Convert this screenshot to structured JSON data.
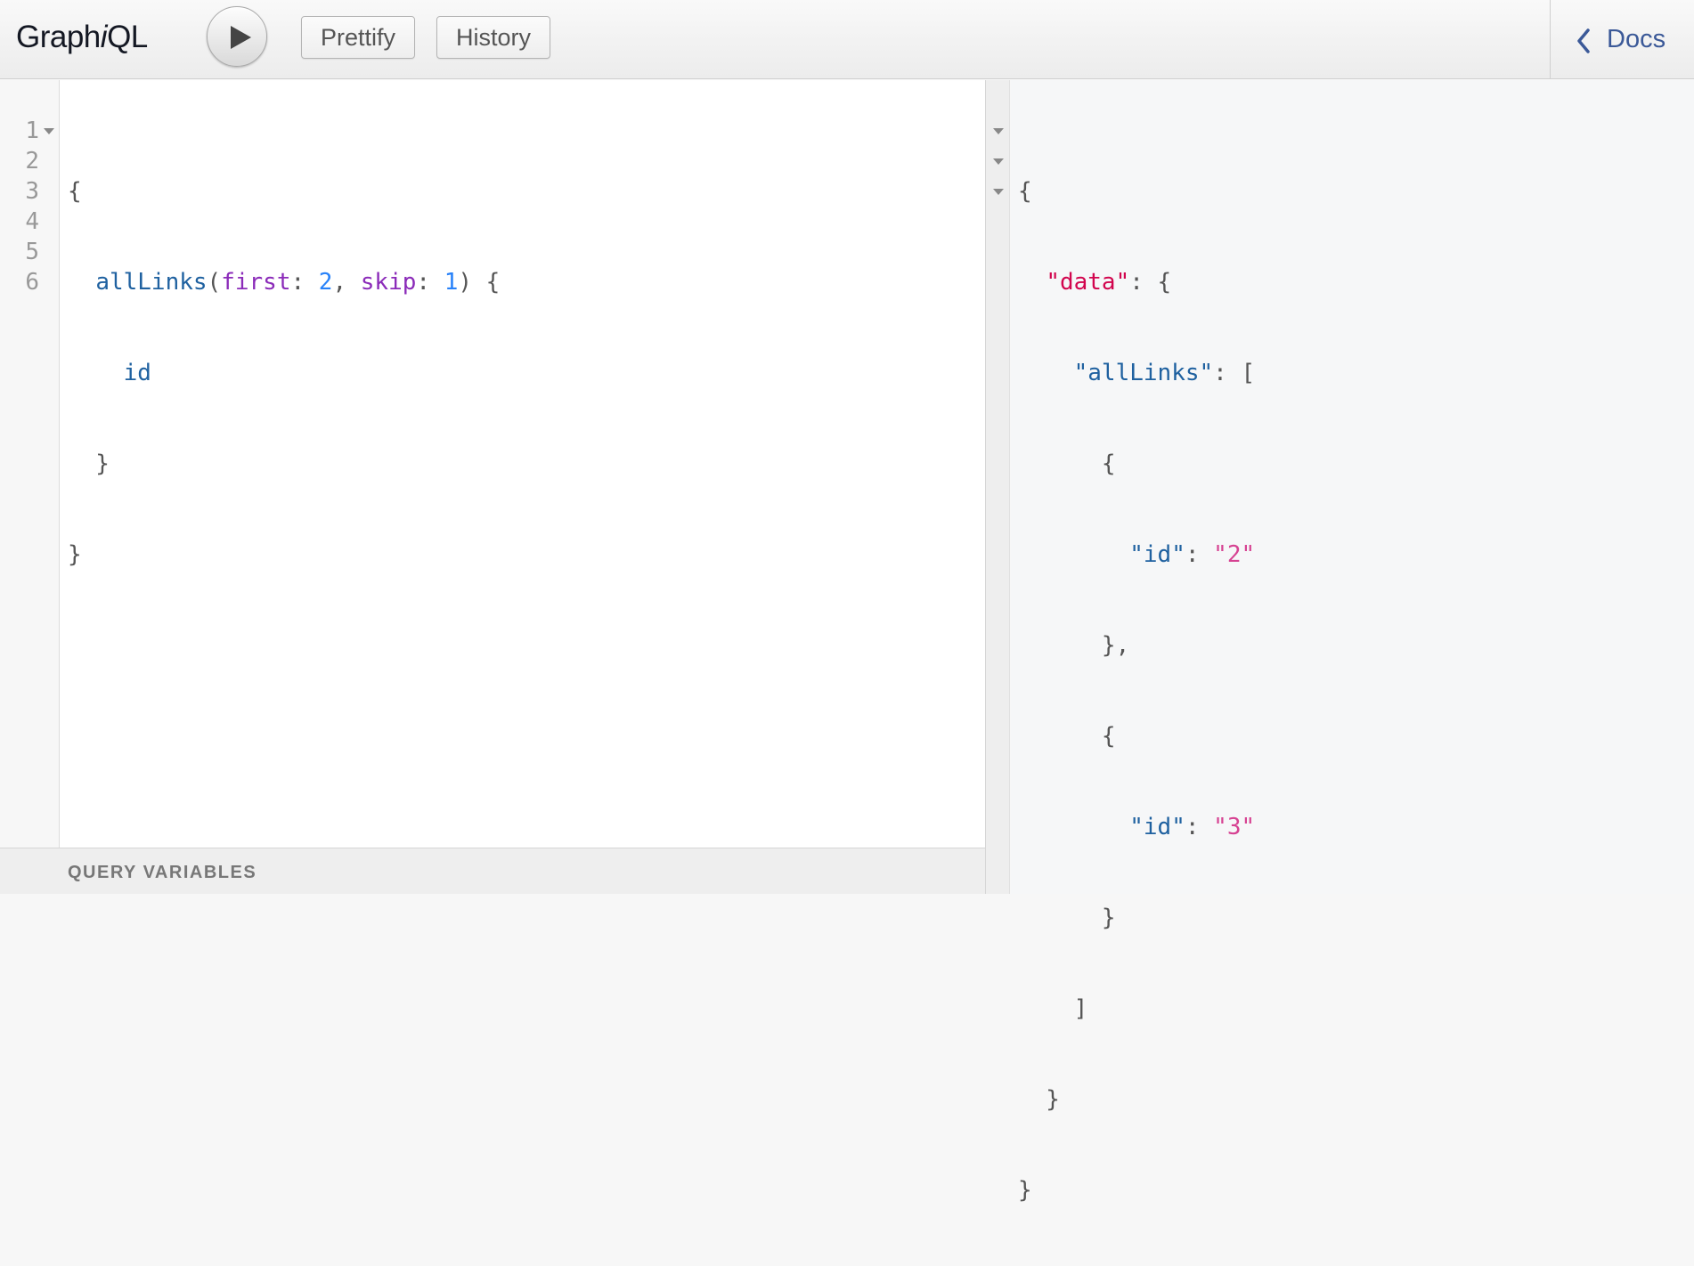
{
  "app": {
    "logo_prefix": "Graph",
    "logo_italic": "i",
    "logo_suffix": "QL"
  },
  "toolbar": {
    "run_icon": "play-icon",
    "prettify_label": "Prettify",
    "history_label": "History",
    "docs_icon": "chevron-left-icon",
    "docs_label": "Docs"
  },
  "query_editor": {
    "line_numbers": [
      "1",
      "2",
      "3",
      "4",
      "5",
      "6"
    ],
    "lines": {
      "l1": {
        "brace": "{"
      },
      "l2": {
        "indent": "  ",
        "field": "allLinks",
        "open_paren": "(",
        "arg1_name": "first",
        "colon1": ": ",
        "arg1_value": "2",
        "comma": ", ",
        "arg2_name": "skip",
        "colon2": ": ",
        "arg2_value": "1",
        "close": ") {"
      },
      "l3": {
        "indent": "    ",
        "field": "id"
      },
      "l4": {
        "text": "  }"
      },
      "l5": {
        "text": "}"
      },
      "l6": {
        "text": ""
      }
    }
  },
  "variables": {
    "title": "QUERY VARIABLES"
  },
  "result": {
    "l1": "{",
    "l2_indent": "  ",
    "l2_key": "\"data\"",
    "l2_rest": ": {",
    "l3_indent": "    ",
    "l3_key": "\"allLinks\"",
    "l3_rest": ": [",
    "l4": "      {",
    "l5_indent": "        ",
    "l5_key": "\"id\"",
    "l5_sep": ": ",
    "l5_value": "\"2\"",
    "l6": "      },",
    "l7": "      {",
    "l8_indent": "        ",
    "l8_key": "\"id\"",
    "l8_sep": ": ",
    "l8_value": "\"3\"",
    "l9": "      }",
    "l10": "    ]",
    "l11": "  }",
    "l12": "}"
  },
  "colors": {
    "field": "#1f61a0",
    "argument": "#8b2bb9",
    "number": "#2882f9",
    "result_key_top": "#d2054e",
    "result_string": "#d64292",
    "docs_link": "#3b5998"
  }
}
